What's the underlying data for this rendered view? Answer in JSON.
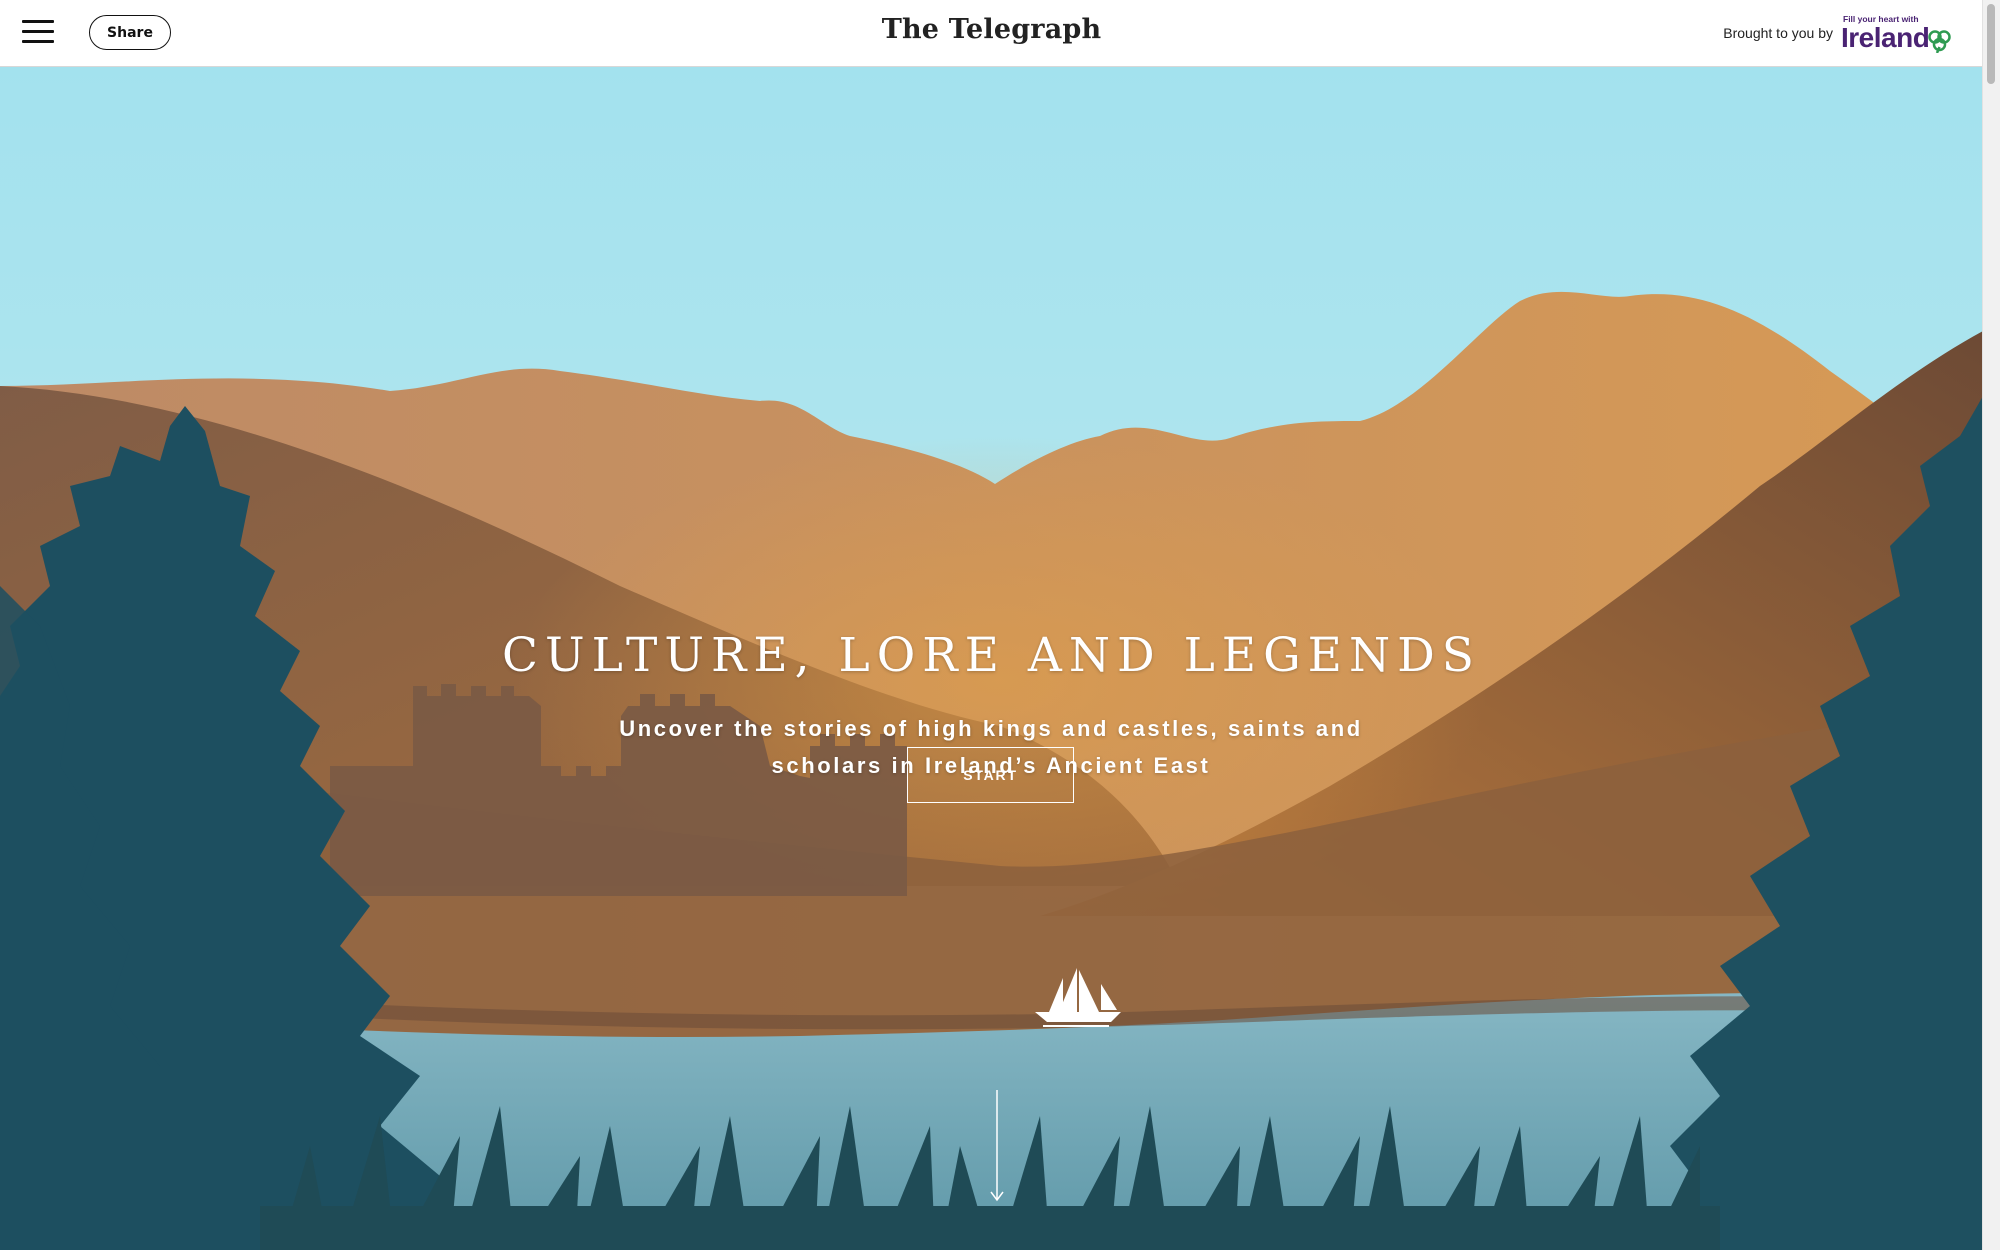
{
  "header": {
    "menu_icon": "hamburger-icon",
    "share_label": "Share",
    "masthead": "The Telegraph",
    "sponsor_prefix": "Brought to you by",
    "sponsor_logo_small": "Fill your heart with",
    "sponsor_logo_word": "Ireland",
    "sponsor_logo_icon": "shamrock-icon"
  },
  "hero": {
    "title": "CULTURE, LORE AND LEGENDS",
    "subtitle": "Uncover the stories of high kings and castles, saints and scholars in Ireland’s Ancient East",
    "start_label": "START",
    "scroll_icon": "arrow-down-icon",
    "ship_icon": "sailing-ship-icon"
  },
  "colors": {
    "sky": "#a5e3ee",
    "mountain_far": "#c99060",
    "hill": "#9a6a43",
    "lake": "#78aab8",
    "trees": "#1e4f5f",
    "sponsor_brand": "#4a2373",
    "shamrock": "#2f9b52"
  }
}
